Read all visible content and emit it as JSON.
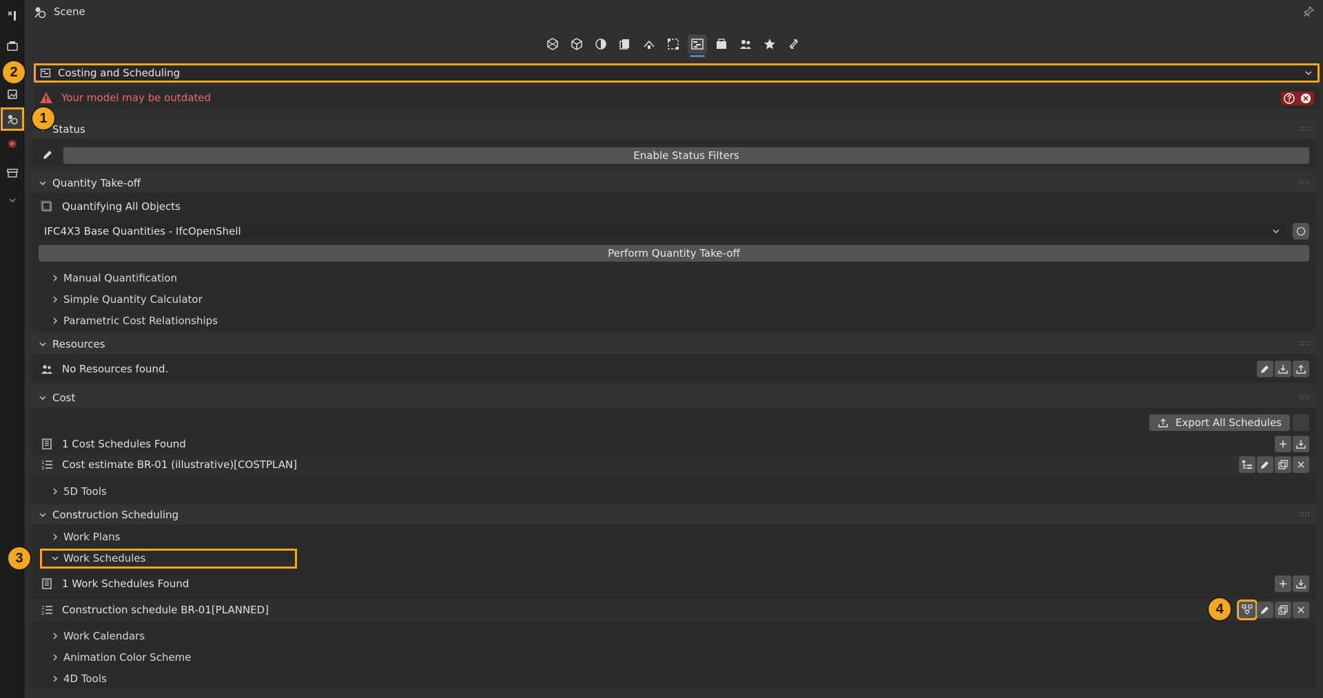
{
  "header": {
    "title": "Scene"
  },
  "mode": {
    "label": "Costing and Scheduling"
  },
  "warning": {
    "text": "Your model may be outdated"
  },
  "status_panel": {
    "title": "Status",
    "button": "Enable Status Filters"
  },
  "qto_panel": {
    "title": "Quantity Take-off",
    "quantifying": "Quantifying All Objects",
    "rule_selected": "IFC4X3 Base Quantities - IfcOpenShell",
    "button": "Perform Quantity Take-off",
    "subs": [
      "Manual Quantification",
      "Simple Quantity Calculator",
      "Parametric Cost Relationships"
    ]
  },
  "resources_panel": {
    "title": "Resources",
    "empty": "No Resources found."
  },
  "cost_panel": {
    "title": "Cost",
    "export": "Export All Schedules",
    "found": "1 Cost Schedules Found",
    "schedule": "Cost estimate BR-01 (illustrative)[COSTPLAN]",
    "sub": "5D Tools"
  },
  "sched_panel": {
    "title": "Construction Scheduling",
    "work_plans": "Work Plans",
    "work_schedules": "Work Schedules",
    "found": "1 Work Schedules Found",
    "schedule": "Construction schedule BR-01[PLANNED]",
    "subs": [
      "Work Calendars",
      "Animation Color Scheme",
      "4D Tools"
    ]
  },
  "markers": [
    "1",
    "2",
    "3",
    "4"
  ],
  "colors": {
    "highlight": "#f5a623",
    "warning_text": "#ea6a6a",
    "accent": "#5680c2"
  }
}
